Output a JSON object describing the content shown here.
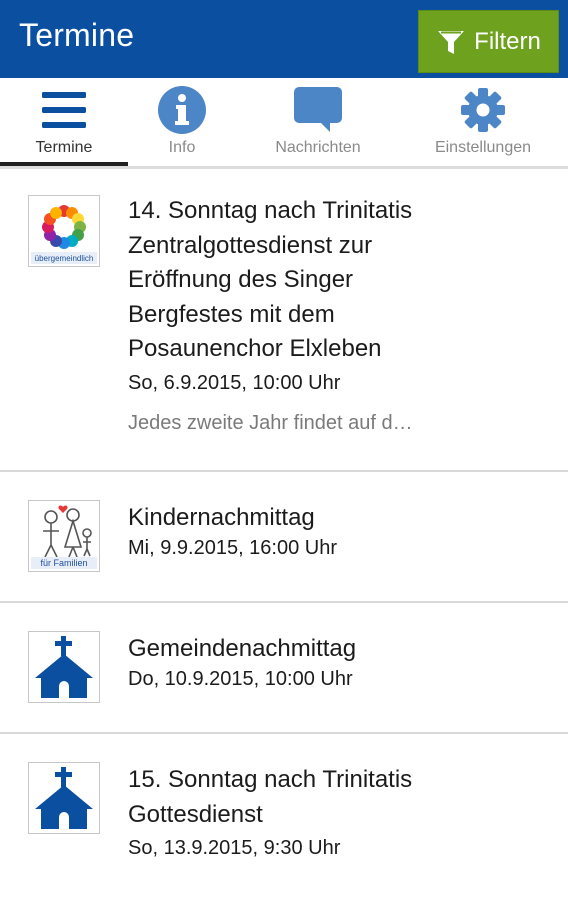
{
  "appbar": {
    "title": "Termine",
    "filter_label": "Filtern",
    "filter_icon": "funnel-icon",
    "background": "#0b50a0",
    "filter_color": "#6ea21e"
  },
  "tabs": [
    {
      "label": "Termine",
      "icon": "menu-icon",
      "active": true
    },
    {
      "label": "Info",
      "icon": "info-icon",
      "active": false
    },
    {
      "label": "Nachrichten",
      "icon": "chat-icon",
      "active": false
    },
    {
      "label": "Einstellungen",
      "icon": "gear-icon",
      "active": false
    }
  ],
  "events": [
    {
      "title_lines": [
        "14. Sonntag nach Trinitatis",
        "Zentralgottesdienst zur",
        "Eröffnung des Singer",
        "Bergfestes mit dem",
        "Posaunenchor Elxleben"
      ],
      "date": "So, 6.9.2015, 10:00 Uhr",
      "description": "Jedes zweite Jahr findet auf d…",
      "thumb": "übergemeindlich-logo",
      "thumb_caption": "übergemeindlich"
    },
    {
      "title_lines": [
        "Kindernachmittag"
      ],
      "date": "Mi, 9.9.2015, 16:00 Uhr",
      "thumb": "family-logo",
      "thumb_caption": "für Familien"
    },
    {
      "title_lines": [
        "Gemeindenachmittag"
      ],
      "date": "Do, 10.9.2015, 10:00 Uhr",
      "thumb": "church-icon"
    },
    {
      "title_lines": [
        "15. Sonntag nach Trinitatis",
        "Gottesdienst"
      ],
      "date": "So, 13.9.2015, 9:30 Uhr",
      "thumb": "church-icon"
    }
  ]
}
